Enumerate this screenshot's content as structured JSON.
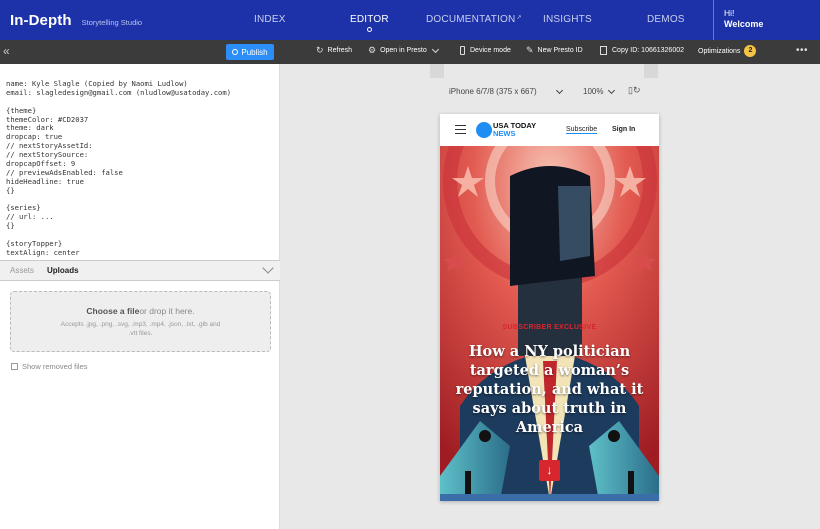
{
  "nav": {
    "brand": "In-Depth",
    "brand_sub": "Storytelling Studio",
    "items": [
      {
        "label": "INDEX"
      },
      {
        "label": "EDITOR"
      },
      {
        "label": "DOCUMENTATION"
      },
      {
        "label": "INSIGHTS"
      },
      {
        "label": "DEMOS"
      }
    ],
    "greeting": "Hi!",
    "welcome": "Welcome"
  },
  "left_toolbar": {
    "collapse_icon": "double-chevron-left-icon",
    "publish_label": "Publish"
  },
  "code_lines": [
    "name: Kyle Slagle (Copied by Naomi Ludlow)",
    "email: slagledesign@gmail.com (nludlow@usatoday.com)",
    "",
    "{theme}",
    "themeColor: #CD2037",
    "theme: dark",
    "dropcap: true",
    "// nextStoryAssetId:",
    "// nextStorySource:",
    "dropcapOffset: 9",
    "// previewAdsEnabled: false",
    "hideHeadline: true",
    "{}",
    "",
    "{series}",
    "// url: ...",
    "{}",
    "",
    "{storyTopper}",
    "textAlign: center"
  ],
  "assets_panel": {
    "tab_assets": "Assets",
    "tab_uploads": "Uploads",
    "dropzone_title_bold": "Choose a file",
    "dropzone_title_rest": "or drop it here.",
    "dropzone_sub": "Accepts .jpg, .png, .svg, .mp3, .mp4, .json, .txt, .glb and .vtt files.",
    "show_removed": "Show removed files"
  },
  "right_toolbar": {
    "refresh": "Refresh",
    "open_in_presto": "Open in Presto",
    "device_mode": "Device mode",
    "new_presto_id": "New Presto ID",
    "copy_id": "Copy ID: 10661326002",
    "optimizations": "Optimizations",
    "optimizations_count": "2",
    "more": "•••"
  },
  "preview_controls": {
    "device": "iPhone 6/7/8 (375 x 667)",
    "zoom": "100%"
  },
  "phone": {
    "logo_line1": "USA TODAY",
    "logo_line2": "NEWS",
    "subscribe": "Subscribe",
    "signin": "Sign In",
    "kicker": "SUBSCRIBER EXCLUSIVE",
    "headline": "How a NY politician targeted a woman’s reputation, and what it says about truth in America",
    "down_arrow": "↓"
  },
  "colors": {
    "nav_bg": "#1d32a8",
    "publish": "#2c8ef8",
    "theme_red": "#d8262e",
    "usat_blue": "#1f8ef2",
    "badge": "#f6c344"
  }
}
